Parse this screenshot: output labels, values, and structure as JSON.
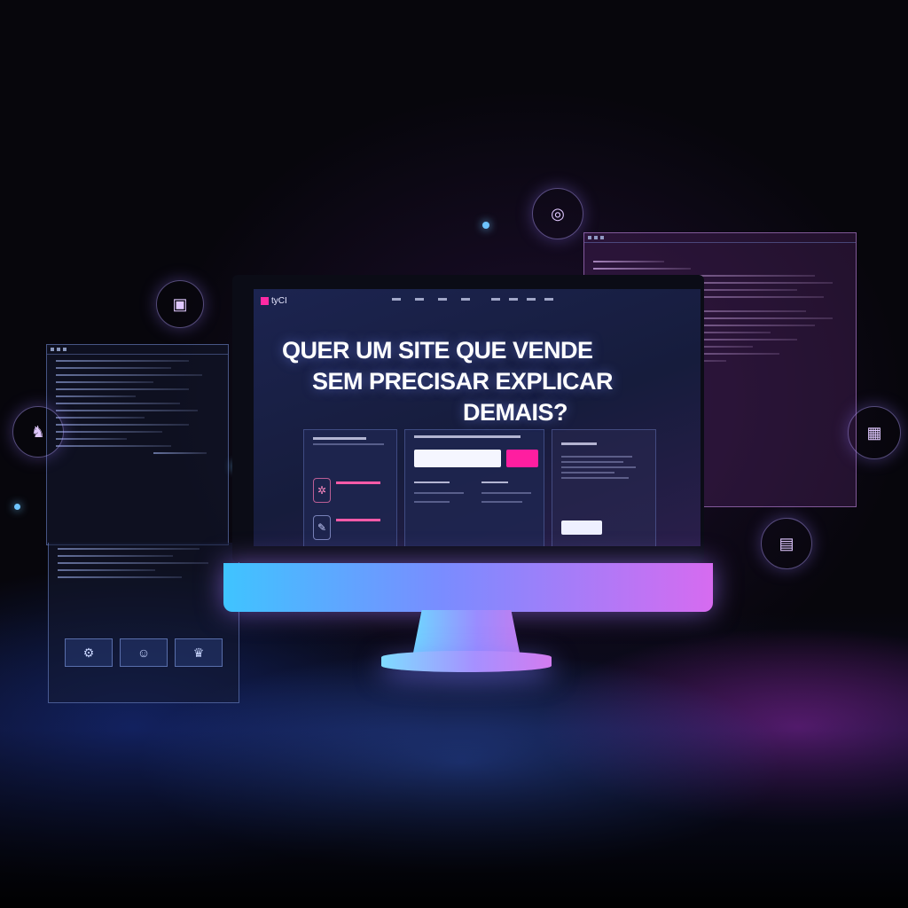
{
  "headline": {
    "line1": "QUER UM SITE QUE VENDE",
    "line2": "SEM PRECISAR EXPLICAR",
    "line3": "DEMAIS?"
  },
  "site": {
    "logo": "tyCI",
    "email_placeholder": ""
  },
  "colors": {
    "accent_pink": "#ff1ea0",
    "accent_cyan": "#3fc4ff",
    "accent_violet": "#d66bf0"
  },
  "icons": [
    "chip-icon",
    "robot-icon",
    "target-icon",
    "lock-icon",
    "cart-icon"
  ]
}
